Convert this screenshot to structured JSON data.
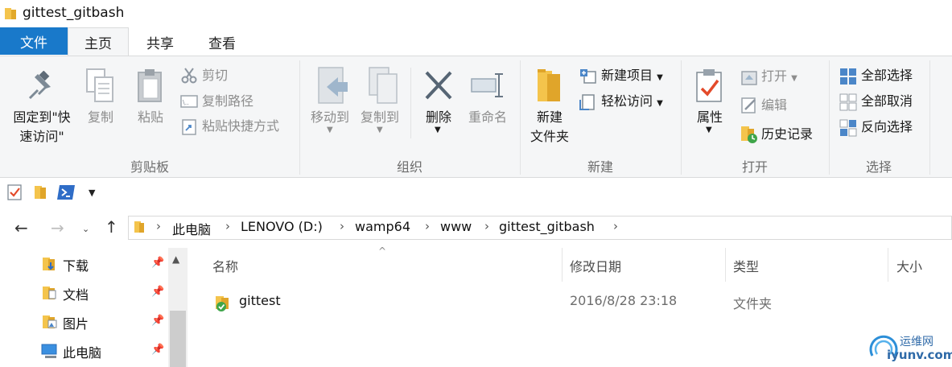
{
  "window": {
    "title": "gittest_gitbash"
  },
  "tabs": {
    "file": "文件",
    "home": "主页",
    "share": "共享",
    "view": "查看"
  },
  "ribbon": {
    "clipboard": {
      "label": "剪贴板",
      "pin_line1": "固定到\"快",
      "pin_line2": "速访问\"",
      "copy": "复制",
      "paste": "粘贴",
      "cut": "剪切",
      "copy_path": "复制路径",
      "paste_shortcut": "粘贴快捷方式"
    },
    "organize": {
      "label": "组织",
      "move_to": "移动到",
      "copy_to": "复制到",
      "delete": "删除",
      "rename": "重命名"
    },
    "new": {
      "label": "新建",
      "new_folder_line1": "新建",
      "new_folder_line2": "文件夹",
      "new_item": "新建项目",
      "easy_access": "轻松访问"
    },
    "open": {
      "label": "打开",
      "properties": "属性",
      "open": "打开",
      "edit": "编辑",
      "history": "历史记录"
    },
    "select": {
      "label": "选择",
      "select_all": "全部选择",
      "select_none": "全部取消",
      "invert": "反向选择"
    }
  },
  "address": {
    "crumbs": [
      "此电脑",
      "LENOVO (D:)",
      "wamp64",
      "www",
      "gittest_gitbash"
    ]
  },
  "nav_pane": {
    "items": [
      {
        "label": "下载"
      },
      {
        "label": "文档"
      },
      {
        "label": "图片"
      },
      {
        "label": "此电脑"
      }
    ]
  },
  "file_list": {
    "columns": {
      "name": "名称",
      "date": "修改日期",
      "type": "类型",
      "size": "大小"
    },
    "rows": [
      {
        "name": "gittest",
        "date": "2016/8/28 23:18",
        "type": "文件夹"
      }
    ]
  },
  "watermark": {
    "line1": "运维网",
    "line2": "iyunv.com"
  },
  "colors": {
    "accent": "#1979ca",
    "folder": "#f4c44c"
  }
}
